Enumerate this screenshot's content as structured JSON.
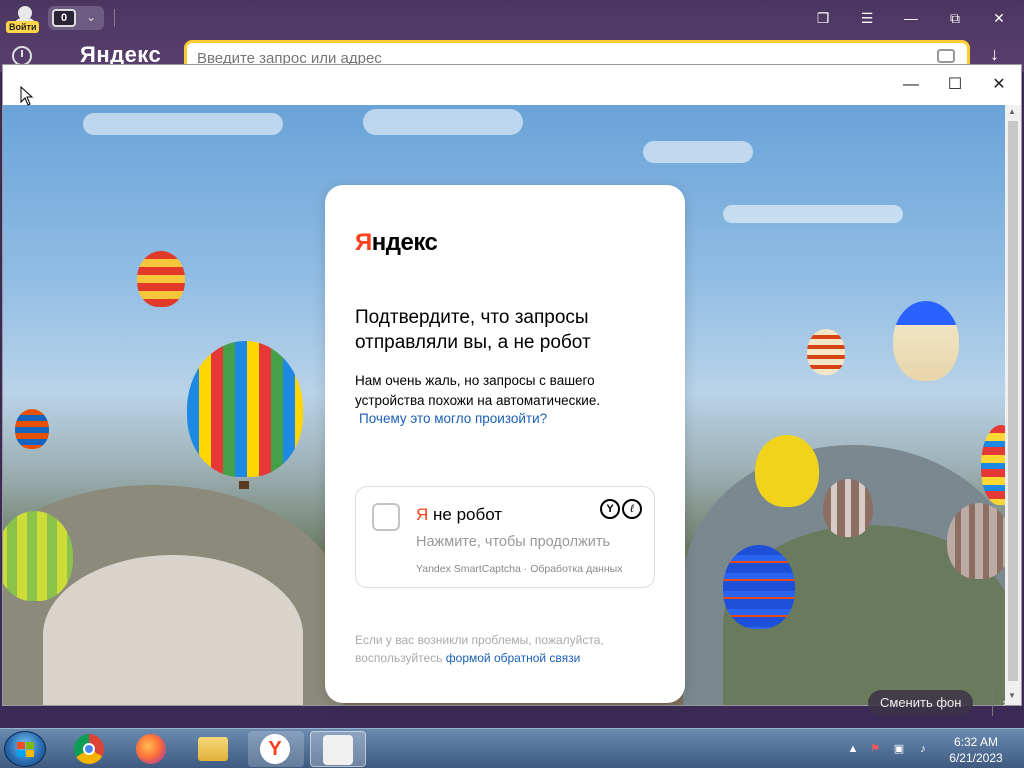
{
  "browser": {
    "login_label": "Войти",
    "tab_count": "0",
    "brand": "Яндекс",
    "address_placeholder": "Введите запрос или адрес"
  },
  "card": {
    "logo_ya": "Я",
    "logo_rest": "ндекс",
    "title": "Подтвердите, что запросы отправляли вы, а не робот",
    "description": "Нам очень жаль, но запросы с вашего устройства похожи на автоматические.",
    "why_link": "Почему это могло произойти?",
    "captcha": {
      "label_ya": "Я",
      "label_rest": " не робот",
      "hint": "Нажмите, чтобы продолжить",
      "footer": "Yandex SmartCaptcha · Обработка данных"
    },
    "problem_text": "Если у вас возникли проблемы, пожалуйста, воспользуйтесь",
    "problem_link": "формой обратной связи"
  },
  "change_background": "Сменить фон",
  "taskbar": {
    "time": "6:32 AM",
    "date": "6/21/2023",
    "apps": [
      "chrome-icon",
      "firefox-icon",
      "file-explorer-icon",
      "yandex-browser-icon",
      "yandex-app-icon"
    ]
  },
  "colors": {
    "yandex_red": "#fc3f1d",
    "link_blue": "#1b5fb5",
    "address_border": "#ffcc33"
  }
}
